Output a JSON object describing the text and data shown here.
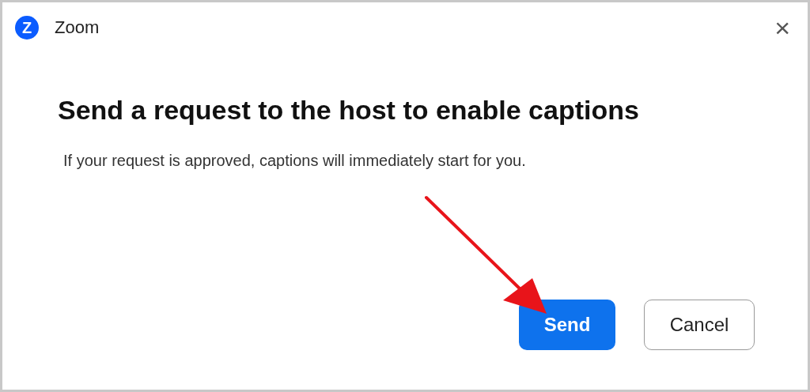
{
  "window": {
    "logo_letter": "Z",
    "title": "Zoom",
    "close": "×"
  },
  "dialog": {
    "heading": "Send a request to the host to enable captions",
    "message": "If your request is approved, captions will immediately start for you."
  },
  "buttons": [
    {
      "label": "Send",
      "kind": "primary"
    },
    {
      "label": "Cancel",
      "kind": "secondary"
    }
  ],
  "annotation": {
    "kind": "arrow"
  }
}
